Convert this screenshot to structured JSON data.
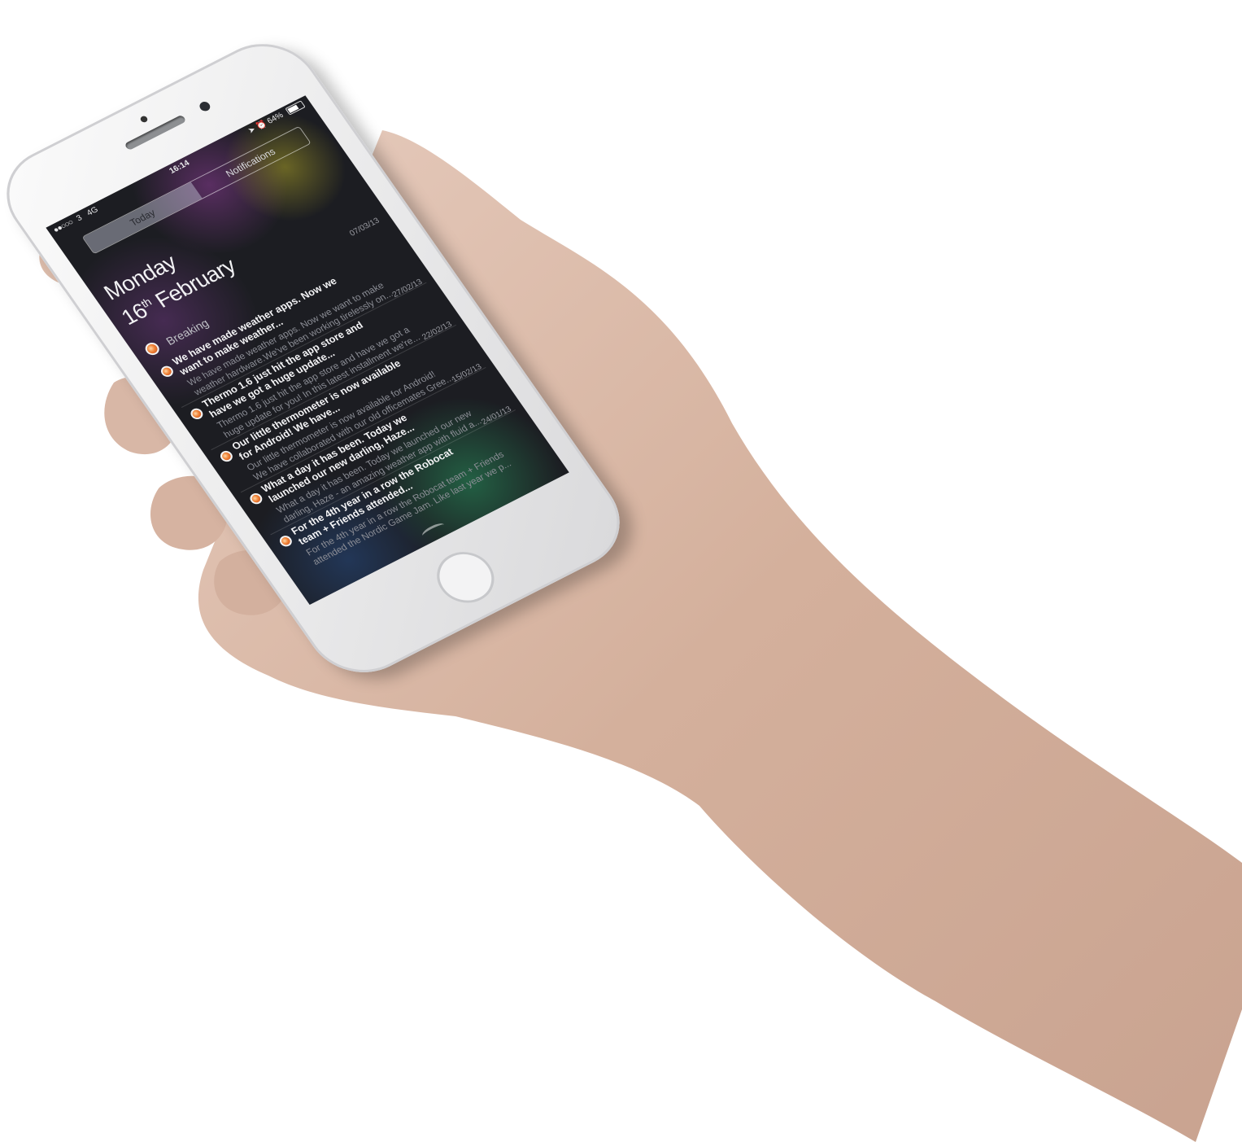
{
  "colors": {
    "accent": "#f08236",
    "screen_bg": "#1c1d22",
    "phone": "#f3f3f4",
    "skin": "#d9b8a6"
  },
  "status_bar": {
    "carrier": "3",
    "network": "4G",
    "time": "16:14",
    "battery": "64%",
    "battery_fraction": 0.64
  },
  "tabs": [
    {
      "label": "Today",
      "active": true
    },
    {
      "label": "Notifications",
      "active": false
    }
  ],
  "date": {
    "weekday": "Monday",
    "day": "16",
    "day_suffix": "th",
    "month": "February"
  },
  "widget": {
    "name": "Breaking",
    "icon": "app-icon",
    "items": [
      {
        "date": "07/03/13",
        "title": "We have made weather apps. Now we want to make weather...",
        "body": "We have made weather apps. Now we want to make",
        "body2": "weather hardware.We've been working tirelessly on..."
      },
      {
        "date": "27/02/13",
        "title": "Thermo 1.6 just hit the app store and have we got a huge update...",
        "body": "Thermo 1.6 just hit the app store and have we got a",
        "body2": "huge update for you! In this latest installment we're..."
      },
      {
        "date": "22/02/13",
        "title": "Our little thermometer is now available for Android! We have...",
        "body": "Our little thermometer is now available for Android!",
        "body2": "We have collaborated with our old officemates Gree..."
      },
      {
        "date": "15/02/13",
        "title": "What a day it has been. Today we launched our new darling, Haze...",
        "body": "What a day it has been. Today we launched our new",
        "body2": "darling, Haze - an amazing weather app with fluid a..."
      },
      {
        "date": "24/01/13",
        "title": "For the 4th year in a row the Robocat team + Friends attended...",
        "body": "For the 4th year in a row the Robocat team + Friends",
        "body2": "attended the Nordic Game Jam. Like last year we p..."
      }
    ]
  }
}
